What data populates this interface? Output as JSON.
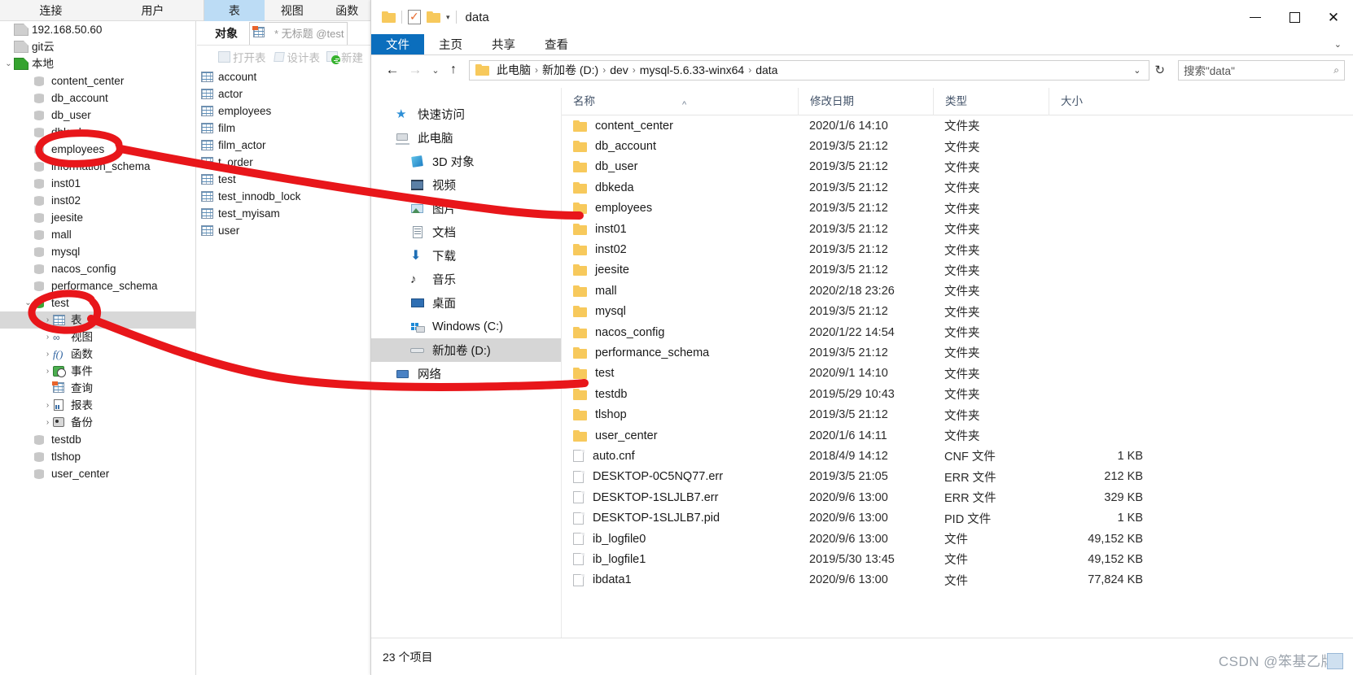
{
  "dbtool": {
    "menu": [
      {
        "label": "连接",
        "active": false
      },
      {
        "label": "用户",
        "active": false
      },
      {
        "label": "表",
        "active": true
      },
      {
        "label": "视图",
        "active": false
      },
      {
        "label": "函数",
        "active": false
      }
    ],
    "tree": [
      {
        "label": "192.168.50.60",
        "icon": "connection-icon",
        "depth": 0,
        "chevron": "",
        "selected": false
      },
      {
        "label": "git云",
        "icon": "connection-icon",
        "depth": 0,
        "chevron": "",
        "selected": false
      },
      {
        "label": "本地",
        "icon": "connection-icon-green",
        "depth": 0,
        "chevron": "v",
        "selected": false
      },
      {
        "label": "content_center",
        "icon": "database-icon",
        "depth": 1,
        "chevron": "",
        "selected": false
      },
      {
        "label": "db_account",
        "icon": "database-icon",
        "depth": 1,
        "chevron": "",
        "selected": false
      },
      {
        "label": "db_user",
        "icon": "database-icon",
        "depth": 1,
        "chevron": "",
        "selected": false
      },
      {
        "label": "dbkeda",
        "icon": "database-icon",
        "depth": 1,
        "chevron": "",
        "selected": false
      },
      {
        "label": "employees",
        "icon": "database-icon",
        "depth": 1,
        "chevron": "",
        "selected": false
      },
      {
        "label": "information_schema",
        "icon": "database-icon",
        "depth": 1,
        "chevron": "",
        "selected": false
      },
      {
        "label": "inst01",
        "icon": "database-icon",
        "depth": 1,
        "chevron": "",
        "selected": false
      },
      {
        "label": "inst02",
        "icon": "database-icon",
        "depth": 1,
        "chevron": "",
        "selected": false
      },
      {
        "label": "jeesite",
        "icon": "database-icon",
        "depth": 1,
        "chevron": "",
        "selected": false
      },
      {
        "label": "mall",
        "icon": "database-icon",
        "depth": 1,
        "chevron": "",
        "selected": false
      },
      {
        "label": "mysql",
        "icon": "database-icon",
        "depth": 1,
        "chevron": "",
        "selected": false
      },
      {
        "label": "nacos_config",
        "icon": "database-icon",
        "depth": 1,
        "chevron": "",
        "selected": false
      },
      {
        "label": "performance_schema",
        "icon": "database-icon",
        "depth": 1,
        "chevron": "",
        "selected": false
      },
      {
        "label": "test",
        "icon": "database-icon-green",
        "depth": 1,
        "chevron": "v",
        "selected": false
      },
      {
        "label": "表",
        "icon": "table-icon",
        "depth": 2,
        "chevron": ">",
        "selected": true
      },
      {
        "label": "视图",
        "icon": "view-icon",
        "depth": 2,
        "chevron": ">",
        "selected": false
      },
      {
        "label": "函数",
        "icon": "function-icon",
        "depth": 2,
        "chevron": ">",
        "selected": false
      },
      {
        "label": "事件",
        "icon": "event-icon",
        "depth": 2,
        "chevron": ">",
        "selected": false
      },
      {
        "label": "查询",
        "icon": "query-icon",
        "depth": 2,
        "chevron": "",
        "selected": false
      },
      {
        "label": "报表",
        "icon": "report-icon",
        "depth": 2,
        "chevron": ">",
        "selected": false
      },
      {
        "label": "备份",
        "icon": "backup-icon",
        "depth": 2,
        "chevron": ">",
        "selected": false
      },
      {
        "label": "testdb",
        "icon": "database-icon",
        "depth": 1,
        "chevron": "",
        "selected": false
      },
      {
        "label": "tlshop",
        "icon": "database-icon",
        "depth": 1,
        "chevron": "",
        "selected": false
      },
      {
        "label": "user_center",
        "icon": "database-icon",
        "depth": 1,
        "chevron": "",
        "selected": false
      }
    ],
    "object_tab": "对象",
    "editor_tab": "* 无标题 @test",
    "toolbar": [
      {
        "label": "打开表",
        "icon": "open-table-icon"
      },
      {
        "label": "设计表",
        "icon": "design-table-icon"
      },
      {
        "label": "新建",
        "icon": "new-table-icon"
      }
    ],
    "tables": [
      "account",
      "actor",
      "employees",
      "film",
      "film_actor",
      "t_order",
      "test",
      "test_innodb_lock",
      "test_myisam",
      "user"
    ]
  },
  "explorer": {
    "title": "data",
    "quick_access": [
      "folder-icon",
      "properties-icon",
      "new-folder-icon",
      "customize-caret-icon"
    ],
    "window_controls": {
      "minimize": "minimize-icon",
      "maximize": "maximize-icon",
      "close": "close-icon"
    },
    "ribbon_tabs": [
      {
        "label": "文件",
        "active": true
      },
      {
        "label": "主页",
        "active": false
      },
      {
        "label": "共享",
        "active": false
      },
      {
        "label": "查看",
        "active": false
      }
    ],
    "breadcrumb": [
      "此电脑",
      "新加卷 (D:)",
      "dev",
      "mysql-5.6.33-winx64",
      "data"
    ],
    "search_placeholder": "搜索\"data\"",
    "nav_items": [
      {
        "label": "快速访问",
        "icon": "star-icon",
        "indent": false,
        "selected": false
      },
      {
        "label": "此电脑",
        "icon": "this-pc-icon",
        "indent": false,
        "selected": false
      },
      {
        "label": "3D 对象",
        "icon": "3d-objects-icon",
        "indent": true,
        "selected": false
      },
      {
        "label": "视频",
        "icon": "videos-icon",
        "indent": true,
        "selected": false
      },
      {
        "label": "图片",
        "icon": "pictures-icon",
        "indent": true,
        "selected": false
      },
      {
        "label": "文档",
        "icon": "documents-icon",
        "indent": true,
        "selected": false
      },
      {
        "label": "下载",
        "icon": "downloads-icon",
        "indent": true,
        "selected": false
      },
      {
        "label": "音乐",
        "icon": "music-icon",
        "indent": true,
        "selected": false
      },
      {
        "label": "桌面",
        "icon": "desktop-icon",
        "indent": true,
        "selected": false
      },
      {
        "label": "Windows (C:)",
        "icon": "windows-drive-icon",
        "indent": true,
        "selected": false
      },
      {
        "label": "新加卷 (D:)",
        "icon": "drive-icon",
        "indent": true,
        "selected": true
      },
      {
        "label": "网络",
        "icon": "network-icon",
        "indent": false,
        "selected": false
      }
    ],
    "columns": [
      {
        "label": "名称",
        "key": "name"
      },
      {
        "label": "修改日期",
        "key": "date"
      },
      {
        "label": "类型",
        "key": "type"
      },
      {
        "label": "大小",
        "key": "size"
      }
    ],
    "sort_indicator": "^",
    "files": [
      {
        "name": "content_center",
        "date": "2020/1/6 14:10",
        "type": "文件夹",
        "size": "",
        "icon": "folder-icon"
      },
      {
        "name": "db_account",
        "date": "2019/3/5 21:12",
        "type": "文件夹",
        "size": "",
        "icon": "folder-icon"
      },
      {
        "name": "db_user",
        "date": "2019/3/5 21:12",
        "type": "文件夹",
        "size": "",
        "icon": "folder-icon"
      },
      {
        "name": "dbkeda",
        "date": "2019/3/5 21:12",
        "type": "文件夹",
        "size": "",
        "icon": "folder-icon"
      },
      {
        "name": "employees",
        "date": "2019/3/5 21:12",
        "type": "文件夹",
        "size": "",
        "icon": "folder-icon"
      },
      {
        "name": "inst01",
        "date": "2019/3/5 21:12",
        "type": "文件夹",
        "size": "",
        "icon": "folder-icon"
      },
      {
        "name": "inst02",
        "date": "2019/3/5 21:12",
        "type": "文件夹",
        "size": "",
        "icon": "folder-icon"
      },
      {
        "name": "jeesite",
        "date": "2019/3/5 21:12",
        "type": "文件夹",
        "size": "",
        "icon": "folder-icon"
      },
      {
        "name": "mall",
        "date": "2020/2/18 23:26",
        "type": "文件夹",
        "size": "",
        "icon": "folder-icon"
      },
      {
        "name": "mysql",
        "date": "2019/3/5 21:12",
        "type": "文件夹",
        "size": "",
        "icon": "folder-icon"
      },
      {
        "name": "nacos_config",
        "date": "2020/1/22 14:54",
        "type": "文件夹",
        "size": "",
        "icon": "folder-icon"
      },
      {
        "name": "performance_schema",
        "date": "2019/3/5 21:12",
        "type": "文件夹",
        "size": "",
        "icon": "folder-icon"
      },
      {
        "name": "test",
        "date": "2020/9/1 14:10",
        "type": "文件夹",
        "size": "",
        "icon": "folder-icon"
      },
      {
        "name": "testdb",
        "date": "2019/5/29 10:43",
        "type": "文件夹",
        "size": "",
        "icon": "folder-icon"
      },
      {
        "name": "tlshop",
        "date": "2019/3/5 21:12",
        "type": "文件夹",
        "size": "",
        "icon": "folder-icon"
      },
      {
        "name": "user_center",
        "date": "2020/1/6 14:11",
        "type": "文件夹",
        "size": "",
        "icon": "folder-icon"
      },
      {
        "name": "auto.cnf",
        "date": "2018/4/9 14:12",
        "type": "CNF 文件",
        "size": "1 KB",
        "icon": "file-icon"
      },
      {
        "name": "DESKTOP-0C5NQ77.err",
        "date": "2019/3/5 21:05",
        "type": "ERR 文件",
        "size": "212 KB",
        "icon": "file-icon"
      },
      {
        "name": "DESKTOP-1SLJLB7.err",
        "date": "2020/9/6 13:00",
        "type": "ERR 文件",
        "size": "329 KB",
        "icon": "file-icon"
      },
      {
        "name": "DESKTOP-1SLJLB7.pid",
        "date": "2020/9/6 13:00",
        "type": "PID 文件",
        "size": "1 KB",
        "icon": "file-icon"
      },
      {
        "name": "ib_logfile0",
        "date": "2020/9/6 13:00",
        "type": "文件",
        "size": "49,152 KB",
        "icon": "file-icon"
      },
      {
        "name": "ib_logfile1",
        "date": "2019/5/30 13:45",
        "type": "文件",
        "size": "49,152 KB",
        "icon": "file-icon"
      },
      {
        "name": "ibdata1",
        "date": "2020/9/6 13:00",
        "type": "文件",
        "size": "77,824 KB",
        "icon": "file-icon"
      }
    ],
    "status": "23 个项目"
  },
  "watermark": "CSDN @笨基乙牌",
  "colors": {
    "accent": "#0b6ebd",
    "annotation": "#e8161a",
    "selection": "#d6d6d6",
    "folder": "#f7c95c",
    "tab_active": "#bcdcf5"
  }
}
